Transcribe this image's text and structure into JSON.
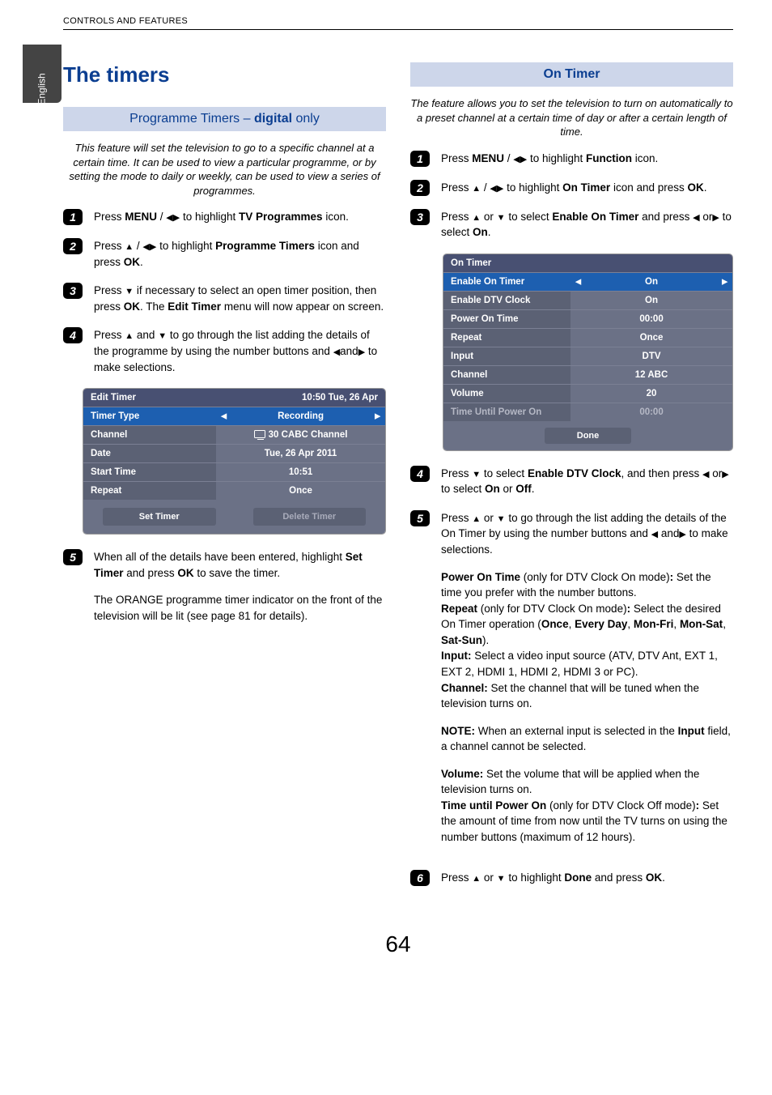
{
  "header": "CONTROLS AND FEATURES",
  "sideTab": "English",
  "pageNumber": "64",
  "left": {
    "title": "The timers",
    "sectionHead_pre": "Programme Timers – ",
    "sectionHead_bold": "digital",
    "sectionHead_post": " only",
    "intro": "This feature will set the television to go to a specific channel at a certain time. It can be used to view a particular programme, or by setting the mode to daily or weekly, can be used to view a series of programmes.",
    "steps": {
      "s1": {
        "a": "Press ",
        "b1": "MENU",
        "c": " / ",
        "d": " to highlight ",
        "b2": "TV Programmes",
        "e": " icon."
      },
      "s2": {
        "a": "Press ",
        "b": " / ",
        "c": " to highlight ",
        "b1": "Programme Timers",
        "d": "  icon and press ",
        "b2": "OK",
        "e": "."
      },
      "s3": {
        "a": "Press ",
        "b": " if necessary to select an open timer position, then press ",
        "b1": "OK",
        "c": ". The ",
        "b2": "Edit Timer",
        "d": " menu will now appear on screen."
      },
      "s4": {
        "a": "Press ",
        "b": " and ",
        "c": " to go through the list adding the details of the programme by using the number buttons and ",
        "d": "and",
        "e": " to make selections."
      },
      "s5": {
        "a": "When all of the details have been entered, highlight ",
        "b1": "Set Timer",
        "b": " and press ",
        "b2": "OK",
        "c": " to save the timer.",
        "p2": "The ORANGE programme timer indicator on the front of the television will be lit (see page 81 for details)."
      }
    },
    "menu": {
      "titleLeft": "Edit Timer",
      "titleRight": "10:50 Tue, 26 Apr",
      "rows": [
        {
          "label": "Timer Type",
          "value": "Recording",
          "arrows": true
        },
        {
          "label": "Channel",
          "value": "30 CABC Channel",
          "tv": true
        },
        {
          "label": "Date",
          "value": "Tue, 26 Apr 2011"
        },
        {
          "label": "Start Time",
          "value": "10:51"
        },
        {
          "label": "Repeat",
          "value": "Once"
        }
      ],
      "btn1": "Set Timer",
      "btn2": "Delete Timer"
    }
  },
  "right": {
    "sectionHead": "On Timer",
    "intro": "The feature allows you to set the television to turn on automatically to a preset channel at a certain time of day or after a certain length of time.",
    "steps": {
      "s1": {
        "a": "Press ",
        "b1": "MENU",
        "b": " / ",
        "c": " to highlight ",
        "b2": "Function",
        "d": " icon."
      },
      "s2": {
        "a": "Press ",
        "b": " / ",
        "c": " to highlight ",
        "b1": "On Timer",
        "d": " icon and press ",
        "b2": "OK",
        "e": "."
      },
      "s3": {
        "a": "Press ",
        "b": " or ",
        "c": " to select ",
        "b1": "Enable On Timer",
        "d": " and press ",
        "e": " or",
        "f": " to select ",
        "b2": "On",
        "g": "."
      },
      "s4": {
        "a": "Press ",
        "b": " to select ",
        "b1": "Enable DTV Clock",
        "c": ", and then press ",
        "d": " or",
        "e": " to select ",
        "b2": "On",
        "f": " or ",
        "b3": "Off",
        "g": "."
      },
      "s5": {
        "a": "Press ",
        "b": " or ",
        "c": " to go through the list adding the details of the On Timer by using the number buttons and ",
        "d": " and",
        "e": " to make selections.",
        "p_power_b": "Power On Time",
        "p_power": " (only for DTV Clock On mode)",
        "p_power2_b": ":",
        "p_power2": " Set the time you prefer with the number buttons.",
        "p_repeat_b": "Repeat",
        "p_repeat": " (only for DTV Clock On mode)",
        "p_repeat2_b": ":",
        "p_repeat2": " Select the desired On Timer operation (",
        "p_repeat_o1": "Once",
        "p_repeat_c1": ", ",
        "p_repeat_o2": "Every Day",
        "p_repeat_c2": ", ",
        "p_repeat_o3": "Mon-Fri",
        "p_repeat_c3": ", ",
        "p_repeat_o4": "Mon-Sat",
        "p_repeat_c4": ", ",
        "p_repeat_o5": "Sat-Sun",
        "p_repeat_end": ").",
        "p_input_b": "Input:",
        "p_input": " Select a video input source (ATV, DTV Ant, EXT 1, EXT 2, HDMI 1, HDMI 2, HDMI 3 or PC).",
        "p_channel_b": "Channel:",
        "p_channel": " Set the channel that will be tuned when the television turns on.",
        "p_note_b": "NOTE:",
        "p_note": " When an external input is selected in the ",
        "p_note_b2": "Input",
        "p_note2": " field, a channel cannot be selected.",
        "p_vol_b": "Volume:",
        "p_vol": " Set the volume that will be applied when the television turns on.",
        "p_time_b": "Time until Power On",
        "p_time": " (only for DTV Clock Off mode)",
        "p_time2_b": ":",
        "p_time2": " Set the amount of time from now until the TV turns on using the number buttons (maximum of 12 hours)."
      },
      "s6": {
        "a": "Press ",
        "b": " or ",
        "c": " to highlight ",
        "b1": "Done",
        "d": " and press ",
        "b2": "OK",
        "e": "."
      }
    },
    "menu": {
      "title": "On Timer",
      "rows": [
        {
          "label": "Enable On Timer",
          "value": "On",
          "blue": true,
          "arrows": true
        },
        {
          "label": "Enable DTV Clock",
          "value": "On"
        },
        {
          "label": "Power On Time",
          "value": "00:00"
        },
        {
          "label": "Repeat",
          "value": "Once"
        },
        {
          "label": "Input",
          "value": "DTV"
        },
        {
          "label": "Channel",
          "value": "12 ABC"
        },
        {
          "label": "Volume",
          "value": "20"
        },
        {
          "label": "Time Until Power On",
          "value": "00:00",
          "grey": true
        }
      ],
      "done": "Done"
    }
  }
}
